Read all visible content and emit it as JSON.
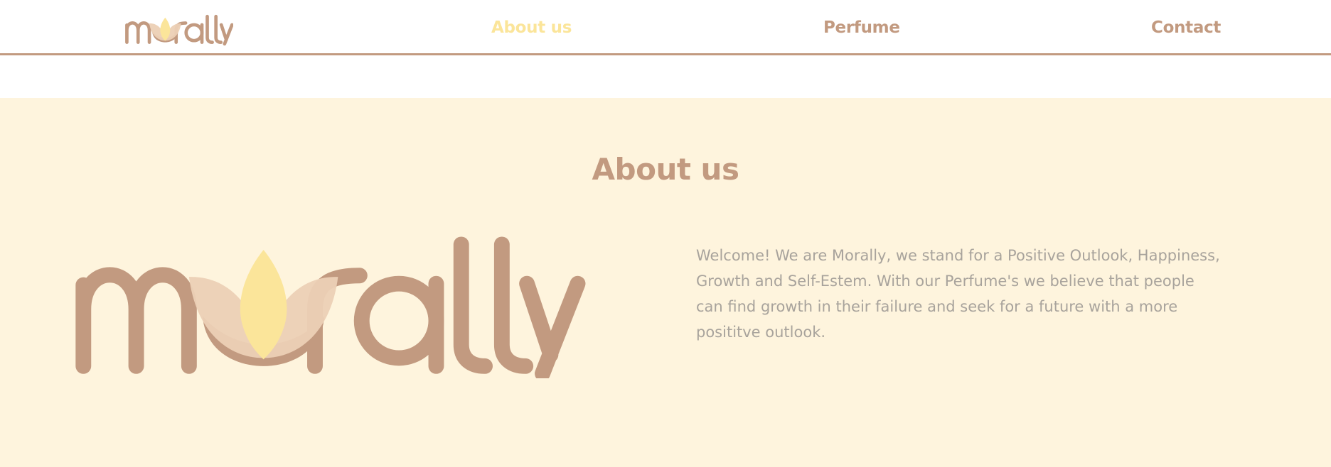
{
  "brand": {
    "name": "morally",
    "logo_icon": "lotus-icon"
  },
  "nav": {
    "items": [
      {
        "label": "About us",
        "active": true
      },
      {
        "label": "Perfume",
        "active": false
      },
      {
        "label": "Contact",
        "active": false
      }
    ]
  },
  "about": {
    "title": "About us",
    "text": "Welcome! We are Morally, we stand for a Positive Outlook, Happiness, Growth and Self-Estem. With our Perfume's we believe that people can find growth in their failure and seek for a future with a more posititve outlook."
  },
  "colors": {
    "brand_brown": "#c29a80",
    "active_yellow": "#fbe59a",
    "section_bg": "#fef4dd",
    "body_text": "#a8a39c",
    "petal_light": "#ecd0b5",
    "petal_yellow": "#fbe59a"
  }
}
